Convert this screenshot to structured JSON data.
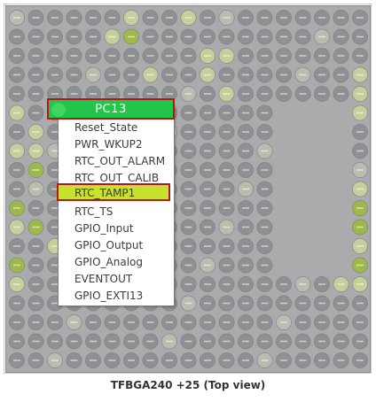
{
  "package": {
    "caption": "TFBGA240 +25 (Top view)"
  },
  "pin_menu": {
    "selected_pin": "PC13",
    "items": [
      "Reset_State",
      "PWR_WKUP2",
      "RTC_OUT_ALARM",
      "RTC_OUT_CALIB",
      "RTC_TAMP1",
      "RTC_TS",
      "GPIO_Input",
      "GPIO_Output",
      "GPIO_Analog",
      "EVENTOUT",
      "GPIO_EXTI13"
    ],
    "highlighted_item": "RTC_TAMP1"
  },
  "colors": {
    "chip_background": "#a9abad",
    "ball_default": "#8e9093",
    "ball_yellow": "#c6cf9c",
    "ball_green": "#9fb84a",
    "ball_power": "#b9bcae",
    "selected_pin": "#22c44a",
    "highlight_item": "#c8e12d",
    "highlight_border": "#b3181a"
  }
}
